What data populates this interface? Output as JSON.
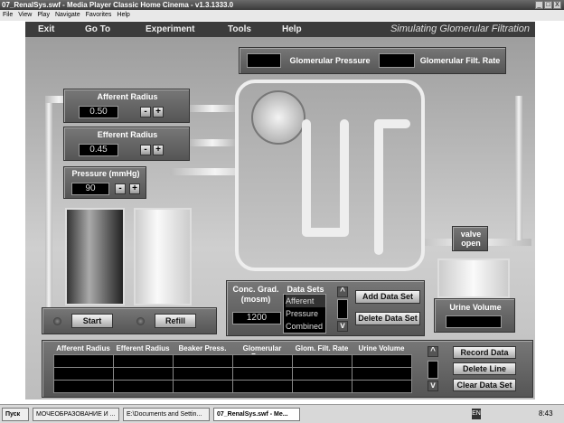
{
  "window": {
    "title": "07_RenalSys.swf - Media Player Classic Home Cinema - v1.3.1333.0",
    "min": "_",
    "max": "□",
    "close": "X"
  },
  "menu": [
    "File",
    "View",
    "Play",
    "Navigate",
    "Favorites",
    "Help"
  ],
  "flash_menu": [
    "Exit",
    "Go To",
    "Experiment",
    "Tools",
    "Help"
  ],
  "sim_title": "Simulating Glomerular Filtration",
  "glom": {
    "pressure_label": "Glomerular Pressure",
    "rate_label": "Glomerular Filt. Rate"
  },
  "afferent": {
    "label": "Afferent Radius",
    "value": "0.50"
  },
  "efferent": {
    "label": "Efferent Radius",
    "value": "0.45"
  },
  "pressure": {
    "label": "Pressure (mmHg)",
    "value": "90"
  },
  "stepper": {
    "minus": "-",
    "plus": "+"
  },
  "controls": {
    "start": "Start",
    "refill": "Refill"
  },
  "valve": {
    "line1": "valve",
    "line2": "open"
  },
  "urine": {
    "label": "Urine Volume"
  },
  "conc": {
    "label1": "Conc. Grad.",
    "label2": "(mosm)",
    "value": "1200"
  },
  "datasets": {
    "label": "Data Sets",
    "items": [
      "Afferent",
      "Pressure",
      "Combined"
    ],
    "up": "^",
    "down": "v",
    "add": "Add Data Set",
    "delete": "Delete Data Set"
  },
  "table": {
    "headers": [
      "Afferent Radius",
      "Efferent Radius",
      "Beaker Press.",
      "Glomerular Press.",
      "Glom. Filt. Rate",
      "Urine Volume"
    ],
    "record": "Record Data",
    "delete_line": "Delete Line",
    "clear": "Clear Data Set"
  },
  "taskbar": {
    "start": "Пуск",
    "tasks": [
      "МОЧЕОБРАЗОВАНИЕ И ...",
      "E:\\Documents and Settin...",
      "07_RenalSys.swf - Me..."
    ],
    "lang": "EN",
    "clock": "8:43"
  }
}
